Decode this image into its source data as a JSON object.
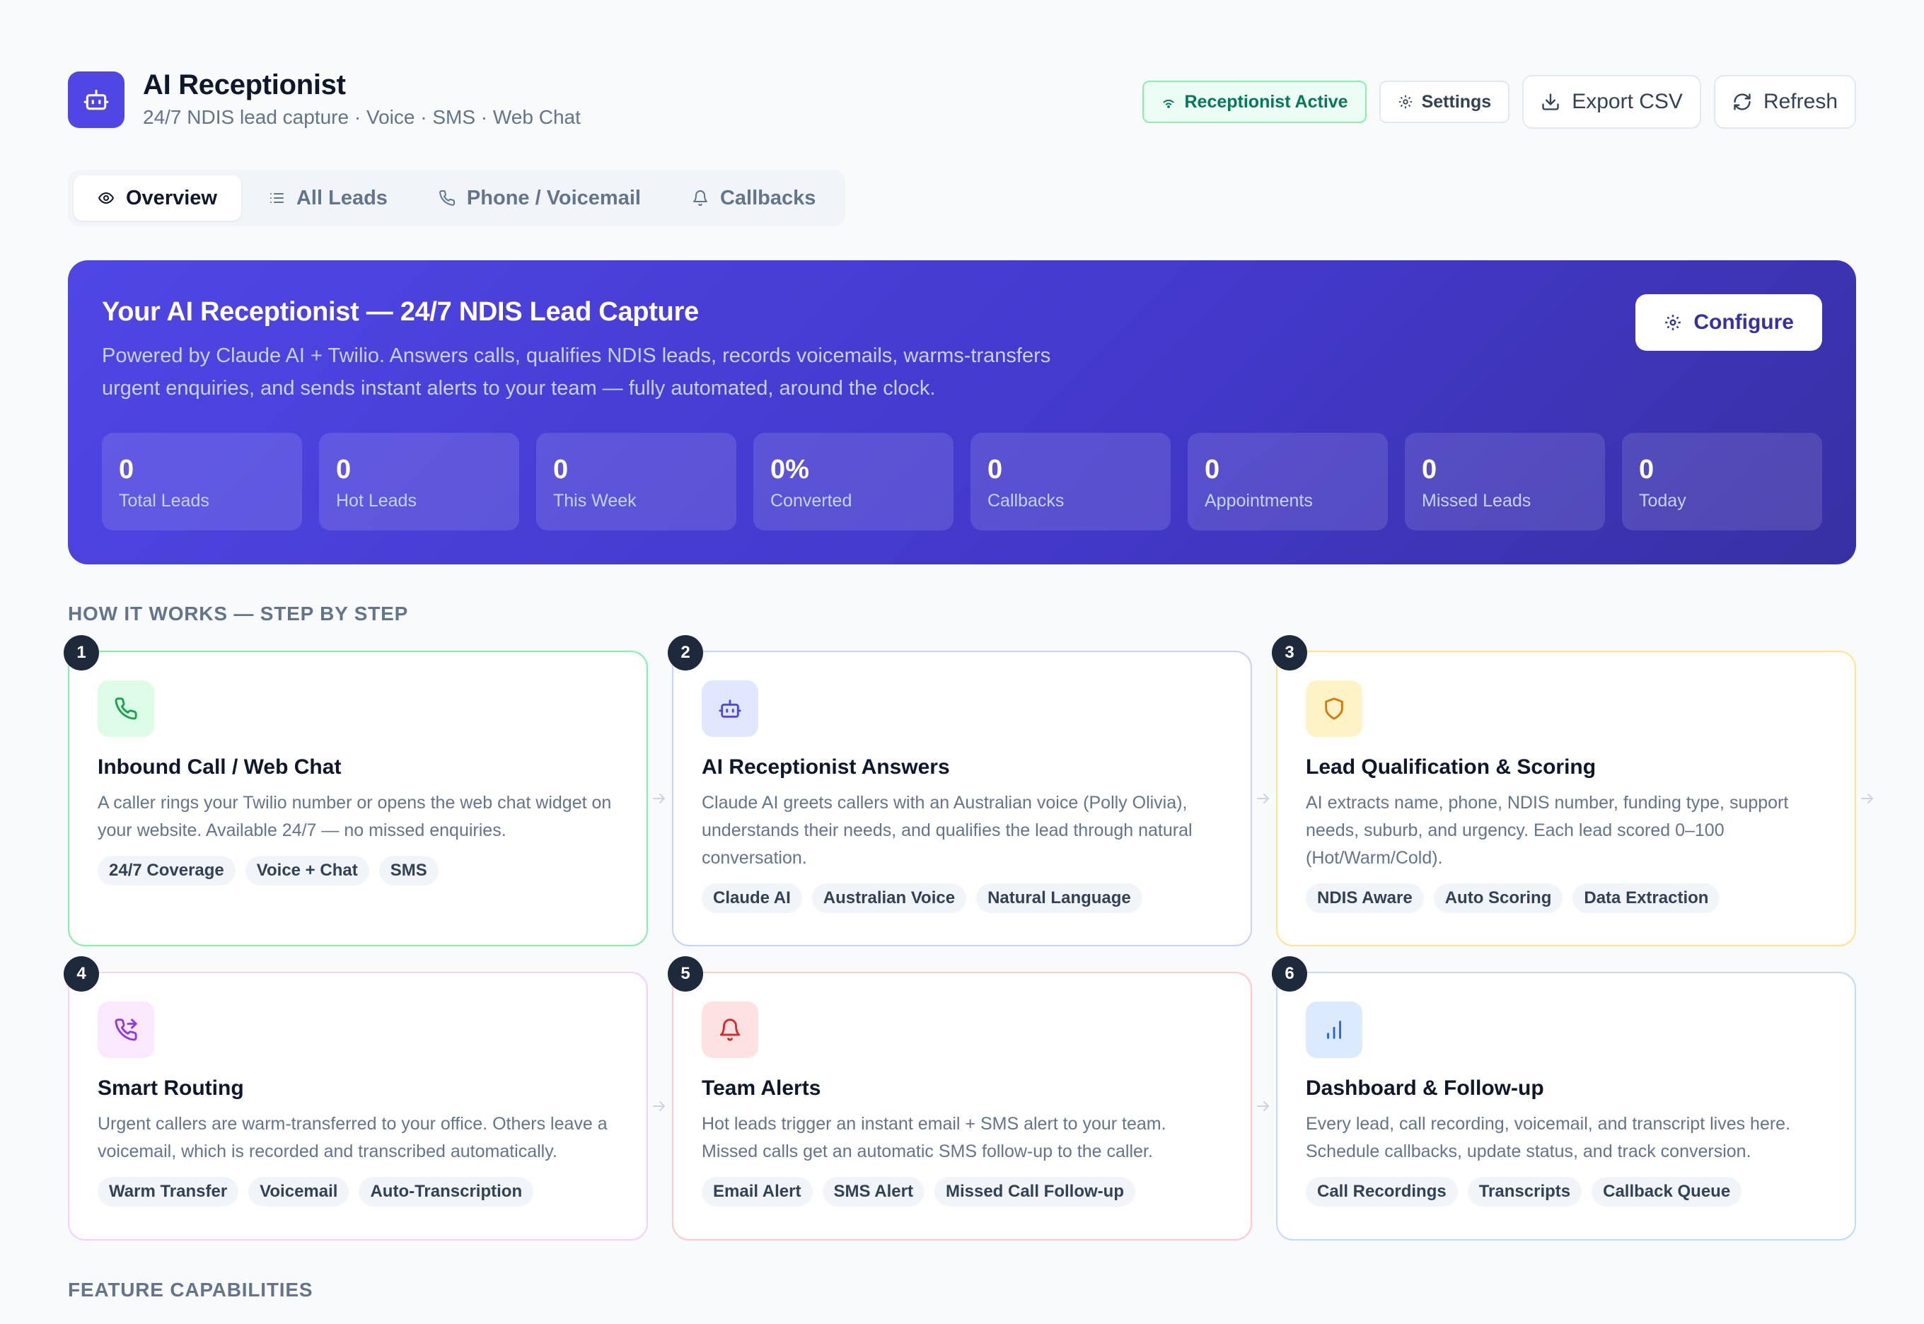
{
  "header": {
    "title": "AI Receptionist",
    "subtitle": "24/7 NDIS lead capture · Voice · SMS · Web Chat",
    "actions": {
      "status": "Receptionist Active",
      "settings": "Settings",
      "export": "Export CSV",
      "refresh": "Refresh"
    }
  },
  "tabs": [
    {
      "label": "Overview",
      "icon": "eye-icon",
      "active": true
    },
    {
      "label": "All Leads",
      "icon": "list-icon"
    },
    {
      "label": "Phone / Voicemail",
      "icon": "phone-icon"
    },
    {
      "label": "Callbacks",
      "icon": "bell-icon"
    }
  ],
  "hero": {
    "title": "Your AI Receptionist — 24/7 NDIS Lead Capture",
    "description": "Powered by Claude AI + Twilio. Answers calls, qualifies NDIS leads, records voicemails, warms-transfers urgent enquiries, and sends instant alerts to your team — fully automated, around the clock.",
    "configure": "Configure",
    "stats": [
      {
        "value": "0",
        "label": "Total Leads"
      },
      {
        "value": "0",
        "label": "Hot Leads"
      },
      {
        "value": "0",
        "label": "This Week"
      },
      {
        "value": "0%",
        "label": "Converted"
      },
      {
        "value": "0",
        "label": "Callbacks"
      },
      {
        "value": "0",
        "label": "Appointments"
      },
      {
        "value": "0",
        "label": "Missed Leads"
      },
      {
        "value": "0",
        "label": "Today"
      }
    ]
  },
  "how_it_works": {
    "title": "HOW IT WORKS — STEP BY STEP",
    "steps": [
      {
        "num": "1",
        "icon": "phone-icon",
        "title": "Inbound Call / Web Chat",
        "desc": "A caller rings your Twilio number or opens the web chat widget on your website. Available 24/7 — no missed enquiries.",
        "chips": [
          "24/7 Coverage",
          "Voice + Chat",
          "SMS"
        ],
        "border": "#86efac",
        "icon_bg": "#dcfce7",
        "icon_color": "#16a34a"
      },
      {
        "num": "2",
        "icon": "bot-icon",
        "title": "AI Receptionist Answers",
        "desc": "Claude AI greets callers with an Australian voice (Polly Olivia), understands their needs, and qualifies the lead through natural conversation.",
        "chips": [
          "Claude AI",
          "Australian Voice",
          "Natural Language"
        ],
        "border": "#c7d2fe",
        "icon_bg": "#e0e7ff",
        "icon_color": "#4f46e5"
      },
      {
        "num": "3",
        "icon": "shield-icon",
        "title": "Lead Qualification & Scoring",
        "desc": "AI extracts name, phone, NDIS number, funding type, support needs, suburb, and urgency. Each lead scored 0–100 (Hot/Warm/Cold).",
        "chips": [
          "NDIS Aware",
          "Auto Scoring",
          "Data Extraction"
        ],
        "border": "#fde68a",
        "icon_bg": "#fef3c7",
        "icon_color": "#d97706"
      },
      {
        "num": "4",
        "icon": "phone-forward-icon",
        "title": "Smart Routing",
        "desc": "Urgent callers are warm-transferred to your office. Others leave a voicemail, which is recorded and transcribed automatically.",
        "chips": [
          "Warm Transfer",
          "Voicemail",
          "Auto-Transcription"
        ],
        "border": "#f5d0fe",
        "icon_bg": "#fae8ff",
        "icon_color": "#9333ea"
      },
      {
        "num": "5",
        "icon": "bell-icon",
        "title": "Team Alerts",
        "desc": "Hot leads trigger an instant email + SMS alert to your team. Missed calls get an automatic SMS follow-up to the caller.",
        "chips": [
          "Email Alert",
          "SMS Alert",
          "Missed Call Follow-up"
        ],
        "border": "#fecaca",
        "icon_bg": "#fee2e2",
        "icon_color": "#dc2626"
      },
      {
        "num": "6",
        "icon": "bar-chart-icon",
        "title": "Dashboard & Follow-up",
        "desc": "Every lead, call recording, voicemail, and transcript lives here. Schedule callbacks, update status, and track conversion.",
        "chips": [
          "Call Recordings",
          "Transcripts",
          "Callback Queue"
        ],
        "border": "#bfdbfe",
        "icon_bg": "#dbeafe",
        "icon_color": "#2563eb"
      }
    ]
  },
  "features": {
    "title": "FEATURE CAPABILITIES"
  }
}
